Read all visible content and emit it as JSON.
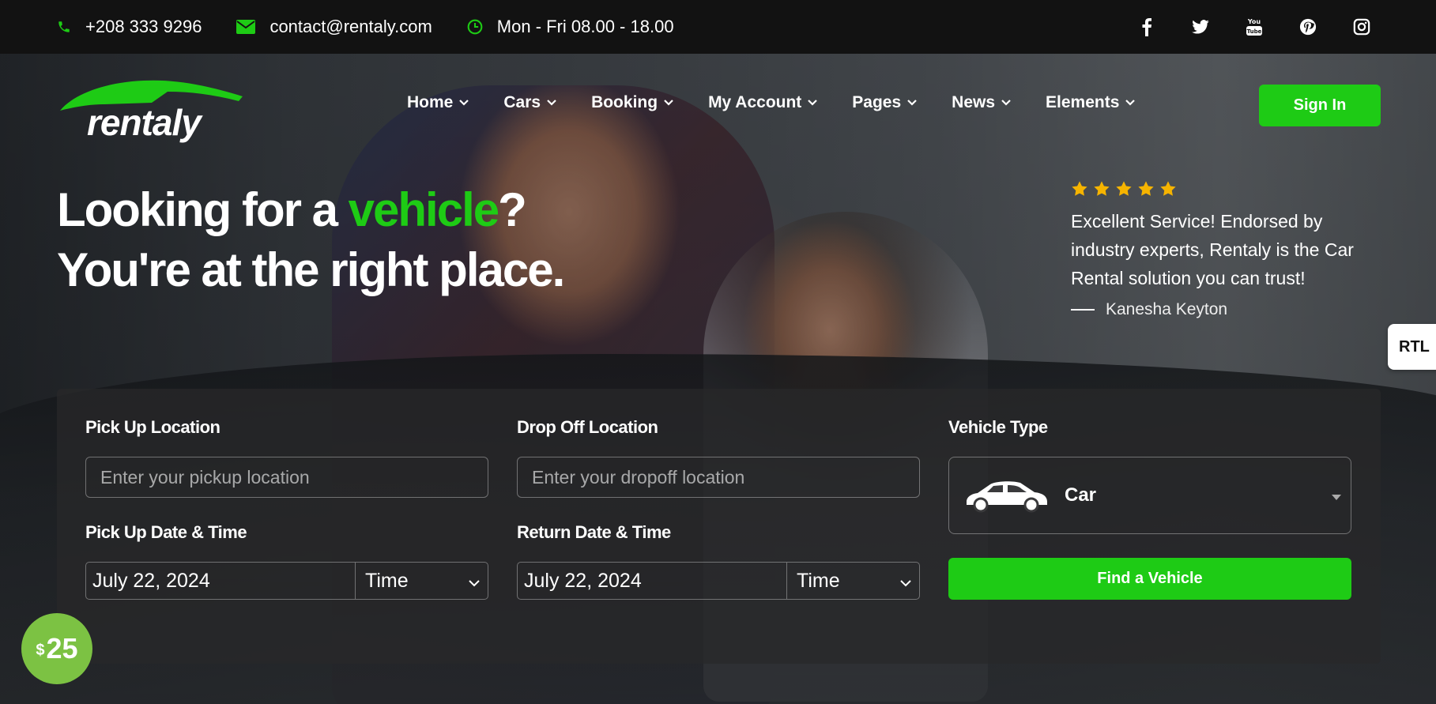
{
  "topbar": {
    "phone": "+208 333 9296",
    "email": "contact@rentaly.com",
    "hours": "Mon - Fri 08.00 - 18.00",
    "socials": [
      "facebook-icon",
      "twitter-icon",
      "youtube-icon",
      "pinterest-icon",
      "instagram-icon"
    ]
  },
  "brand": {
    "name": "rentaly",
    "accent": "#1ecb15"
  },
  "nav": {
    "items": [
      "Home",
      "Cars",
      "Booking",
      "My Account",
      "Pages",
      "News",
      "Elements"
    ],
    "signin": "Sign In"
  },
  "hero": {
    "line1_pre": "Looking for a ",
    "line1_accent": "vehicle",
    "line1_post": "?",
    "line2": "You're at the right place."
  },
  "testimonial": {
    "stars": 5,
    "quote": "Excellent Service! Endorsed by industry experts, Rentaly is the Car Rental solution you can trust!",
    "author": "Kanesha Keyton"
  },
  "rtl_label": "RTL",
  "booking": {
    "pickup_label": "Pick Up Location",
    "pickup_placeholder": "Enter your pickup location",
    "dropoff_label": "Drop Off Location",
    "dropoff_placeholder": "Enter your dropoff location",
    "vehicle_type_label": "Vehicle Type",
    "vehicle_type_value": "Car",
    "pickup_dt_label": "Pick Up Date & Time",
    "pickup_date": "July 22, 2024",
    "pickup_time": "Time",
    "return_dt_label": "Return Date & Time",
    "return_date": "July 22, 2024",
    "return_time": "Time",
    "find_button": "Find a Vehicle"
  },
  "price_badge": {
    "currency": "$",
    "amount": "25"
  }
}
